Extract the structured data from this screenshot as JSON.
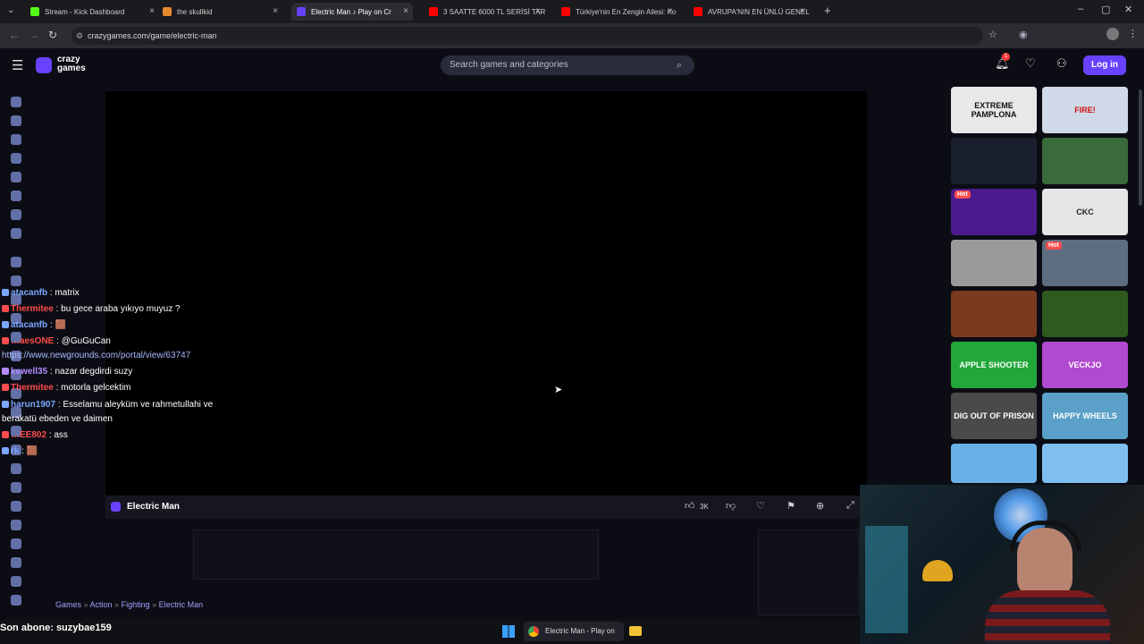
{
  "tabs": [
    {
      "label": "Stream - Kick Dashboard",
      "color": "#53fc18"
    },
    {
      "label": "the skullkid",
      "color": "#e88a2f"
    },
    {
      "label": "Electric Man ♪ Play on Cr",
      "color": "#6842ff"
    },
    {
      "label": "3 SAATTE 6000 TL SERİSİ TARSİ",
      "color": "#ff0000"
    },
    {
      "label": "Türkiye'nin En Zengin Ailesi: Ko",
      "color": "#ff0000"
    },
    {
      "label": "AVRUPA'NIN EN ÜNLÜ GENELE",
      "color": "#ff0000"
    }
  ],
  "address": {
    "url": "crazygames.com/game/electric-man"
  },
  "header": {
    "logo_top": "crazy",
    "logo_bottom": "games",
    "search_placeholder": "Search games and categories",
    "notif_count": "1",
    "login_label": "Log in"
  },
  "chat": [
    {
      "user": "atacanfb",
      "msg": ": matrix",
      "color": "#7aa7ff"
    },
    {
      "user": "Thermitee",
      "msg": ": bu gece araba yıkıyo muyuz ?",
      "color": "#ff4d4d"
    },
    {
      "user": "atacanfb",
      "msg": ": 🟫",
      "color": "#7aa7ff"
    },
    {
      "user": "…aesONE",
      "msg": ": @GuGuCan",
      "color": "#ff4d4d"
    },
    {
      "user": "",
      "msg": "https://www.newgrounds.com/portal/view/63747",
      "color": "#a9b8ff"
    },
    {
      "user": "kewell35",
      "msg": ": nazar degdirdi suzy",
      "color": "#b48cff"
    },
    {
      "user": "Thermitee",
      "msg": ": motorla gelcektim",
      "color": "#ff4d4d"
    },
    {
      "user": "harun1907",
      "msg": ": Esselamu aleyküm ve rahmetullahi ve",
      "color": "#7aa7ff"
    },
    {
      "user": "",
      "msg": "berakatü ebeden ve daimen",
      "color": "#ffffff"
    },
    {
      "user": "…EE802",
      "msg": ": ass",
      "color": "#ff4d4d"
    },
    {
      "user": "rk",
      "msg": ": 🟫",
      "color": "#7aa7ff"
    }
  ],
  "game": {
    "title": "Electric Man",
    "likes": "3K"
  },
  "breadcrumb": [
    "Games",
    "Action",
    "Fighting",
    "Electric Man"
  ],
  "thumbs": [
    {
      "label": "EXTREME PAMPLONA",
      "bg": "#e8e8e8",
      "fg": "#111",
      "hot": false
    },
    {
      "label": "FIRE!",
      "bg": "#cfd9e8",
      "fg": "#d01010",
      "hot": false
    },
    {
      "label": "",
      "bg": "#1a1f2e",
      "fg": "#fff",
      "hot": false
    },
    {
      "label": "",
      "bg": "#3a6b3a",
      "fg": "#fff",
      "hot": false
    },
    {
      "label": "",
      "bg": "#4b1a8c",
      "fg": "#ffe04d",
      "hot": true
    },
    {
      "label": "CKC",
      "bg": "#e6e6e6",
      "fg": "#222",
      "hot": false
    },
    {
      "label": "",
      "bg": "#9a9a9a",
      "fg": "#fff",
      "hot": false
    },
    {
      "label": "",
      "bg": "#5e6e80",
      "fg": "#fff",
      "hot": true
    },
    {
      "label": "",
      "bg": "#7a3a1e",
      "fg": "#fff",
      "hot": false
    },
    {
      "label": "",
      "bg": "#2e5a1e",
      "fg": "#fff",
      "hot": false
    },
    {
      "label": "APPLE SHOOTER",
      "bg": "#22a83a",
      "fg": "#fff",
      "hot": false
    },
    {
      "label": "VECKJO",
      "bg": "#b04ad0",
      "fg": "#fff",
      "hot": false
    },
    {
      "label": "DIG OUT OF PRISON",
      "bg": "#4a4a4a",
      "fg": "#fff",
      "hot": false
    },
    {
      "label": "HAPPY WHEELS",
      "bg": "#5aa0c8",
      "fg": "#fff",
      "hot": false
    },
    {
      "label": "",
      "bg": "#6ab0e8",
      "fg": "#fff",
      "hot": false
    },
    {
      "label": "",
      "bg": "#7fbff0",
      "fg": "#fff",
      "hot": false
    }
  ],
  "subscriber": {
    "text": "Son abone: suzybae159"
  },
  "taskbar": {
    "app_label": "Electric Man - Play on"
  }
}
